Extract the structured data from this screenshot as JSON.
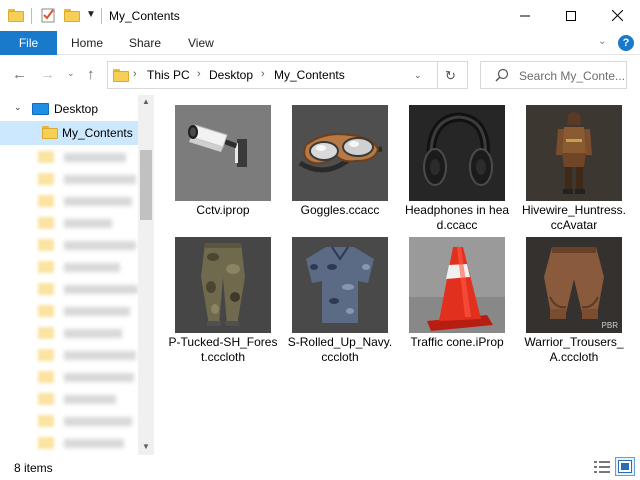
{
  "window": {
    "title": "My_Contents",
    "minimize_icon": "minimize-icon",
    "maximize_icon": "maximize-icon",
    "close_icon": "close-icon"
  },
  "ribbon": {
    "tabs": [
      "File",
      "Home",
      "Share",
      "View"
    ],
    "accent": "#1979ca"
  },
  "address": {
    "crumbs": [
      "This PC",
      "Desktop",
      "My_Contents"
    ],
    "search_placeholder": "Search My_Conte..."
  },
  "nav": {
    "items": [
      {
        "label": "Desktop",
        "icon": "desktop-icon"
      },
      {
        "label": "My_Contents",
        "icon": "folder-icon",
        "selected": true
      }
    ]
  },
  "files": [
    {
      "name": "Cctv.iprop",
      "thumb": "cctv-camera-thumbnail"
    },
    {
      "name": "Goggles.ccacc",
      "thumb": "goggles-thumbnail"
    },
    {
      "name": "Headphones in head.ccacc",
      "thumb": "headphones-thumbnail"
    },
    {
      "name": "Hivewire_Huntress.ccAvatar",
      "thumb": "huntress-avatar-thumbnail"
    },
    {
      "name": "P-Tucked-SH_Forest.cccloth",
      "thumb": "camo-pants-thumbnail"
    },
    {
      "name": "S-Rolled_Up_Navy.cccloth",
      "thumb": "navy-shirt-thumbnail"
    },
    {
      "name": "Traffic cone.iProp",
      "thumb": "traffic-cone-thumbnail"
    },
    {
      "name": "Warrior_Trousers_A.cccloth",
      "thumb": "warrior-trousers-thumbnail",
      "badge": "PBR"
    }
  ],
  "status": {
    "item_count": "8 items"
  }
}
